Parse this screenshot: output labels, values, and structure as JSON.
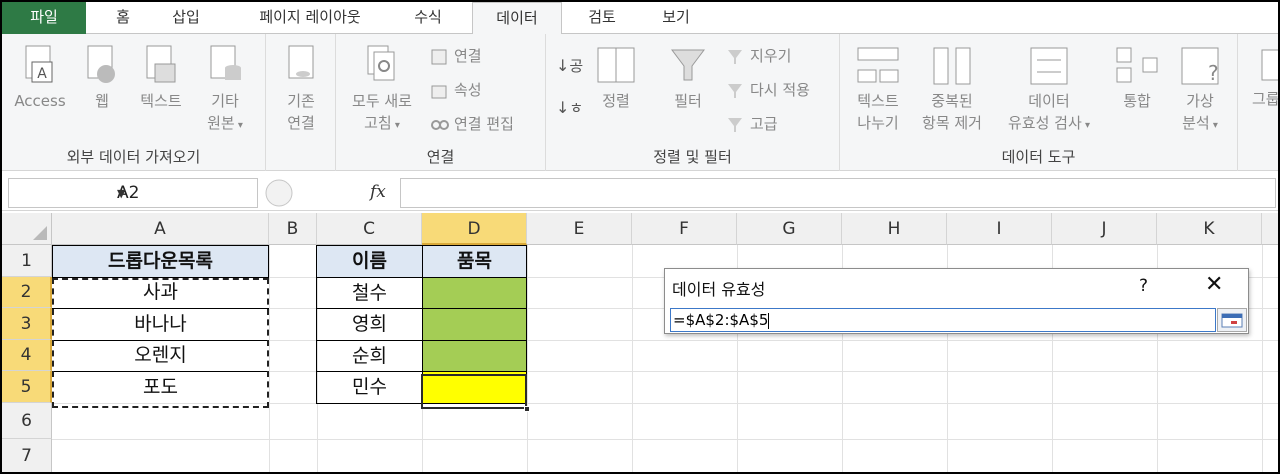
{
  "tabs": [
    {
      "label": "파일"
    },
    {
      "label": "홈"
    },
    {
      "label": "삽입"
    },
    {
      "label": "페이지 레이아웃"
    },
    {
      "label": "수식"
    },
    {
      "label": "데이터"
    },
    {
      "label": "검토"
    },
    {
      "label": "보기"
    }
  ],
  "active_tab": "데이터",
  "ribbon": {
    "external": {
      "group_label": "외부 데이터 가져오기",
      "access": "Access",
      "web": "웹",
      "text": "텍스트",
      "other_1": "기타",
      "other_2": "원본"
    },
    "connections": {
      "group_label": "연결",
      "existing_1": "기존",
      "existing_2": "연결",
      "refresh_1": "모두 새로",
      "refresh_2": "고침",
      "connections": "연결",
      "properties": "속성",
      "edit_links": "연결 편집"
    },
    "sort_filter": {
      "group_label": "정렬 및 필터",
      "sort_az": "공",
      "sort_ha": "ㅎ",
      "sort": "정렬",
      "filter": "필터",
      "clear": "지우기",
      "reapply": "다시 적용",
      "advanced": "고급"
    },
    "data_tools": {
      "group_label": "데이터 도구",
      "text_to_cols_1": "텍스트",
      "text_to_cols_2": "나누기",
      "remove_dup_1": "중복된",
      "remove_dup_2": "항목 제거",
      "validation_1": "데이터",
      "validation_2": "유효성 검사",
      "consolidate": "통합",
      "whatif_1": "가상",
      "whatif_2": "분석"
    },
    "outline": {
      "group_1": "그룹"
    }
  },
  "formula_bar": {
    "name_box": "A2",
    "fx": "fx",
    "formula": ""
  },
  "grid": {
    "columns": [
      "A",
      "B",
      "C",
      "D",
      "E",
      "F",
      "G",
      "H",
      "I",
      "J",
      "K"
    ],
    "rows": [
      "1",
      "2",
      "3",
      "4",
      "5",
      "6",
      "7"
    ],
    "cells": {
      "a1": "드롭다운목록",
      "a2": "사과",
      "a3": "바나나",
      "a4": "오렌지",
      "a5": "포도",
      "c1": "이름",
      "c2": "철수",
      "c3": "영희",
      "c4": "순희",
      "c5": "민수",
      "d1": "품목"
    },
    "colors": {
      "header_fill": "#dde7f3",
      "green_fill": "#a4cd55",
      "yellow_fill": "#ffff00"
    }
  },
  "dialog": {
    "title": "데이터 유효성",
    "help": "?",
    "close": "✕",
    "value": "=$A$2:$A$5"
  }
}
